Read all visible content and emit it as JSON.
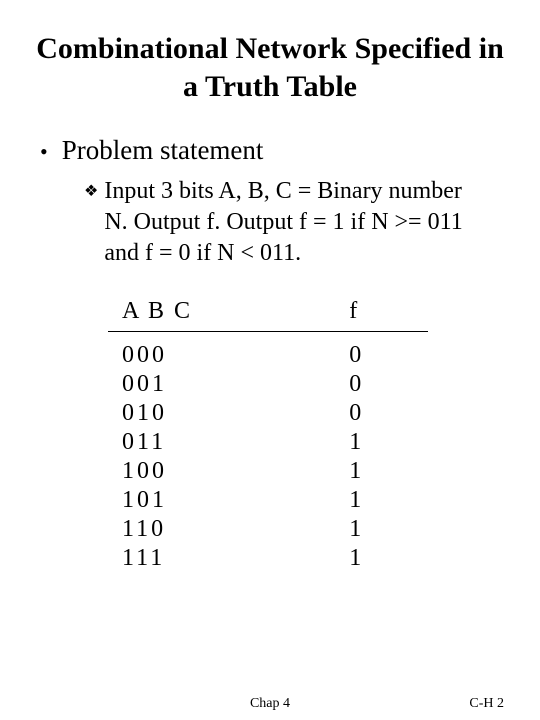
{
  "title": "Combinational Network Specified in a Truth Table",
  "bullets": {
    "l1": "Problem statement",
    "l2": "Input 3 bits A, B, C = Binary number N. Output f. Output f = 1 if N >= 011 and f = 0 if N < 011."
  },
  "table": {
    "header": {
      "abc": "A B C",
      "f": "f"
    },
    "rows": [
      {
        "abc": "000",
        "f": "0"
      },
      {
        "abc": "001",
        "f": "0"
      },
      {
        "abc": "010",
        "f": "0"
      },
      {
        "abc": "011",
        "f": "1"
      },
      {
        "abc": "100",
        "f": "1"
      },
      {
        "abc": "101",
        "f": "1"
      },
      {
        "abc": "110",
        "f": "1"
      },
      {
        "abc": "111",
        "f": "1"
      }
    ]
  },
  "footer": {
    "center": "Chap 4",
    "right": "C-H 2"
  },
  "chart_data": {
    "type": "table",
    "title": "Truth table for f (f = 1 iff N >= 011)",
    "columns": [
      "A",
      "B",
      "C",
      "f"
    ],
    "rows": [
      [
        0,
        0,
        0,
        0
      ],
      [
        0,
        0,
        1,
        0
      ],
      [
        0,
        1,
        0,
        0
      ],
      [
        0,
        1,
        1,
        1
      ],
      [
        1,
        0,
        0,
        1
      ],
      [
        1,
        0,
        1,
        1
      ],
      [
        1,
        1,
        0,
        1
      ],
      [
        1,
        1,
        1,
        1
      ]
    ]
  }
}
